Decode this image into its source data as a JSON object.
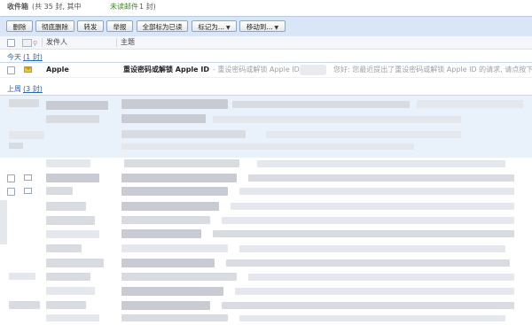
{
  "title": {
    "folder": "收件箱",
    "count_text": "(共 35 封, 其中",
    "unread_text": "未读邮件",
    "unread_count": "1 封)"
  },
  "toolbar": {
    "delete": "删除",
    "delete_perm": "彻底删除",
    "forward": "转发",
    "report": "举报",
    "mark_all_read": "全部标为已读",
    "mark_as": "标记为...",
    "move_to": "移动到..."
  },
  "header": {
    "sender": "发件人",
    "subject": "主题"
  },
  "groups": {
    "today": {
      "label": "今天",
      "count": "(1 封)"
    },
    "last_week": {
      "label": "上周",
      "count": "(3 封)"
    }
  },
  "message": {
    "sender": "Apple",
    "subject": "重设密码或解锁 Apple ID",
    "preview_a": "- 重设密码或解锁 Apple ID",
    "preview_b": "您好: 您最近提出了重设密码或解锁 Apple ID 的请求, 请点按下"
  },
  "colors": {
    "toolbar_bg": "#d9e6f7",
    "link_blue": "#2a64b5",
    "unread_green": "#3b8a1f",
    "unread_envelope": "#f2c23b"
  }
}
